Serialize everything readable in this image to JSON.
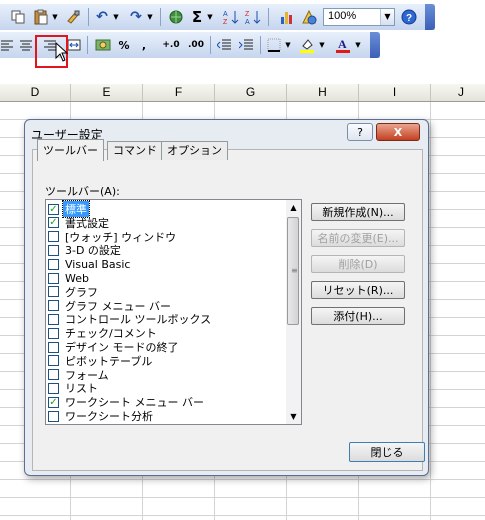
{
  "toolbar_top": {
    "zoom_value": "100%",
    "icons": [
      "paste-icon",
      "paste-dropdown",
      "format-painter-icon",
      "undo-icon",
      "redo-icon",
      "hyperlink-icon",
      "autosum-icon",
      "sort-ascending-icon",
      "sort-descending-icon",
      "chart-wizard-icon",
      "drawing-icon",
      "zoom-box",
      "help-icon"
    ]
  },
  "toolbar_format": {
    "percent_label": "%",
    "comma_label": ",",
    "increase_decimal_label": "+.0",
    "decrease_decimal_label": ".00"
  },
  "columns": [
    "D",
    "E",
    "F",
    "G",
    "H",
    "I",
    "J"
  ],
  "dialog": {
    "title": "ユーザー設定",
    "help_glyph": "?",
    "close_glyph": "X",
    "tabs": [
      "ツールバー",
      "コマンド",
      "オプション"
    ],
    "list_label": "ツールバー(A):",
    "items": [
      {
        "label": "標準",
        "checked": true,
        "selected": true
      },
      {
        "label": "書式設定",
        "checked": true,
        "selected": false
      },
      {
        "label": "[ウォッチ] ウィンドウ",
        "checked": false,
        "selected": false
      },
      {
        "label": "3-D の設定",
        "checked": false,
        "selected": false
      },
      {
        "label": "Visual Basic",
        "checked": false,
        "selected": false
      },
      {
        "label": "Web",
        "checked": false,
        "selected": false
      },
      {
        "label": "グラフ",
        "checked": false,
        "selected": false
      },
      {
        "label": "グラフ メニュー バー",
        "checked": false,
        "selected": false
      },
      {
        "label": "コントロール ツールボックス",
        "checked": false,
        "selected": false
      },
      {
        "label": "チェック/コメント",
        "checked": false,
        "selected": false
      },
      {
        "label": "デザイン モードの終了",
        "checked": false,
        "selected": false
      },
      {
        "label": "ピボットテーブル",
        "checked": false,
        "selected": false
      },
      {
        "label": "フォーム",
        "checked": false,
        "selected": false
      },
      {
        "label": "リスト",
        "checked": false,
        "selected": false
      },
      {
        "label": "ワークシート メニュー バー",
        "checked": true,
        "selected": false
      },
      {
        "label": "ワークシート分析",
        "checked": false,
        "selected": false
      }
    ],
    "buttons": {
      "new": "新規作成(N)...",
      "rename": "名前の変更(E)...",
      "delete": "削除(D)",
      "reset": "リセット(R)...",
      "attach": "添付(H)..."
    },
    "close_button": "閉じる"
  }
}
